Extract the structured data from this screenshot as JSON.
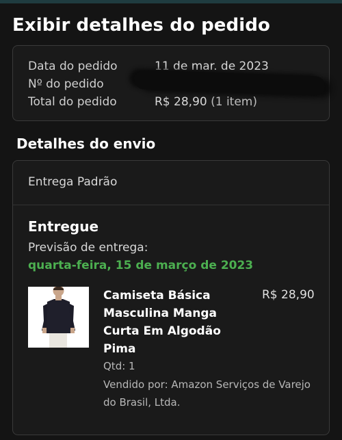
{
  "page": {
    "title": "Exibir detalhes do pedido"
  },
  "summary": {
    "date_label": "Data do pedido",
    "date_value": "11 de mar. de 2023",
    "order_number_label": "Nº do pedido",
    "total_label": "Total do pedido",
    "total_value": "R$ 28,90",
    "total_items": "(1 item)"
  },
  "shipping": {
    "section_title": "Detalhes do envio",
    "method": "Entrega Padrão",
    "status": "Entregue",
    "eta_label": "Previsão de entrega:",
    "eta_date": "quarta-feira, 15 de março de 2023",
    "item": {
      "name": "Camiseta Básica Masculina Manga Curta Em Algodão Pima",
      "price": "R$ 28,90",
      "quantity": "Qtd: 1",
      "seller": "Vendido por: Amazon Serviços de Varejo do Brasil, Ltda.",
      "image_icon": "tshirt-product-photo"
    }
  },
  "colors": {
    "background": "#141414",
    "accent_green": "#4caf50",
    "card_border": "#3a3a3a"
  }
}
